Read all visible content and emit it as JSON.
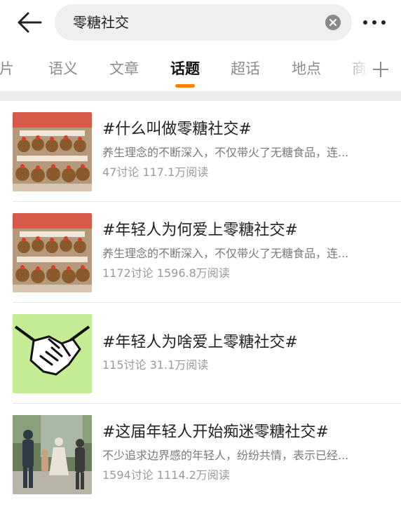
{
  "header": {
    "back_icon": "arrow-left-icon",
    "search_value": "零糖社交",
    "clear_icon": "close-circle-icon",
    "more_icon": "more-dots-icon"
  },
  "tabs": [
    {
      "label": "图片"
    },
    {
      "label": "语义"
    },
    {
      "label": "文章"
    },
    {
      "label": "话题",
      "active": true
    },
    {
      "label": "超话"
    },
    {
      "label": "地点"
    },
    {
      "label": "商"
    }
  ],
  "tabs_add_icon": "plus-icon",
  "accent_color": "#ff8200",
  "topics": [
    {
      "title": "#什么叫做零糖社交#",
      "desc": "养生理念的不断深入，不仅带火了无糖食品，连...",
      "meta": "47讨论 117.1万阅读",
      "thumb": "plush-toys-image"
    },
    {
      "title": "#年轻人为何爱上零糖社交#",
      "desc": "养生理念的不断深入，不仅带火了无糖食品，连...",
      "meta": "1172讨论 1596.8万阅读",
      "thumb": "plush-toys-image"
    },
    {
      "title": "#年轻人为啥爱上零糖社交#",
      "desc": "",
      "meta": "115讨论 31.1万阅读",
      "thumb": "handshake-image"
    },
    {
      "title": "#这届年轻人开始痴迷零糖社交#",
      "desc": "不少追求边界感的年轻人，纷纷共情，表示已经...",
      "meta": "1594讨论 1114.2万阅读",
      "thumb": "people-photo-image"
    }
  ]
}
